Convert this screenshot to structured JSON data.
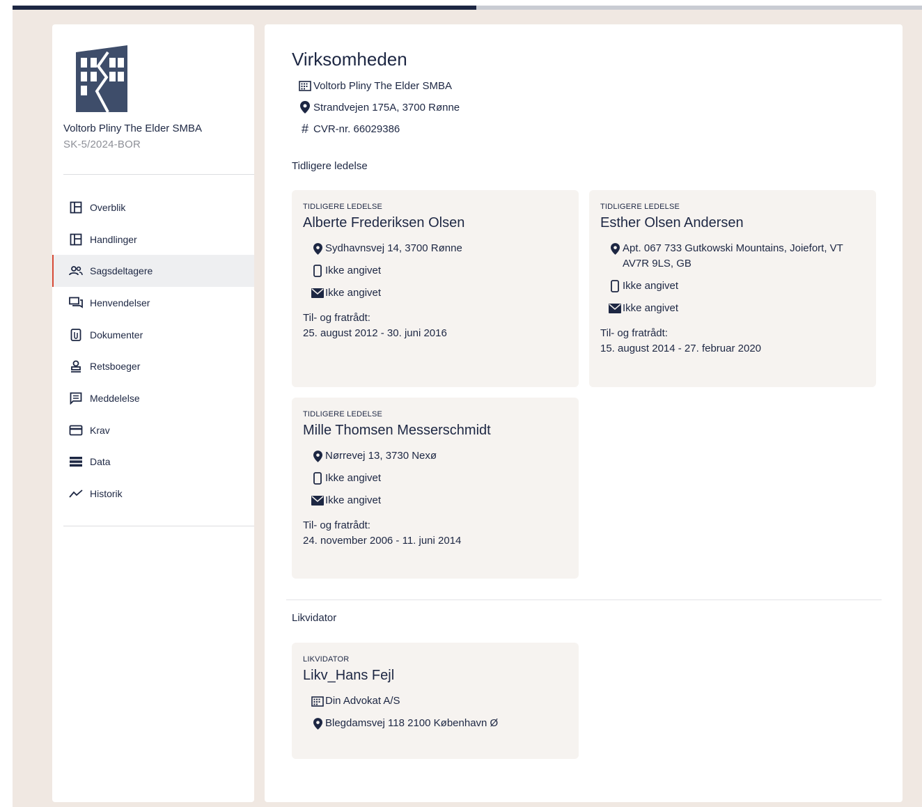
{
  "progress": {
    "fraction": 0.51
  },
  "sidebar": {
    "company_name": "Voltorb Pliny The Elder SMBA",
    "case_number": "SK-5/2024-BOR",
    "items": [
      {
        "label": "Overblik",
        "icon": "layout-icon"
      },
      {
        "label": "Handlinger",
        "icon": "layout-icon"
      },
      {
        "label": "Sagsdeltagere",
        "icon": "people-icon",
        "active": true
      },
      {
        "label": "Henvendelser",
        "icon": "chat-icon"
      },
      {
        "label": "Dokumenter",
        "icon": "document-icon"
      },
      {
        "label": "Retsboeger",
        "icon": "stamp-icon"
      },
      {
        "label": "Meddelelse",
        "icon": "message-icon"
      },
      {
        "label": "Krav",
        "icon": "card-icon"
      },
      {
        "label": "Data",
        "icon": "list-icon"
      },
      {
        "label": "Historik",
        "icon": "trend-icon"
      }
    ]
  },
  "main": {
    "title": "Virksomheden",
    "company_line": "Voltorb Pliny The Elder SMBA",
    "address_line": "Strandvejen 175A, 3700 Rønne",
    "cvr_line": "CVR-nr. 66029386",
    "section_previous": "Tidligere ledelse",
    "section_liquidator": "Likvidator",
    "period_label": "Til- og fratrådt:",
    "previous_management": [
      {
        "kicker": "TIDLIGERE LEDELSE",
        "name": "Alberte Frederiksen Olsen",
        "address": "Sydhavnsvej 14, 3700 Rønne",
        "phone": "Ikke angivet",
        "email": "Ikke angivet",
        "period": "25. august 2012 - 30. juni 2016"
      },
      {
        "kicker": "TIDLIGERE LEDELSE",
        "name": "Esther Olsen Andersen",
        "address": "Apt. 067 733 Gutkowski Mountains, Joiefort, VT AV7R 9LS, GB",
        "phone": "Ikke angivet",
        "email": "Ikke angivet",
        "period": "15. august 2014 - 27. februar 2020"
      },
      {
        "kicker": "TIDLIGERE LEDELSE",
        "name": "Mille Thomsen Messerschmidt",
        "address": "Nørrevej 13, 3730 Nexø",
        "phone": "Ikke angivet",
        "email": "Ikke angivet",
        "period": "24. november 2006 - 11. juni 2014"
      }
    ],
    "liquidator": {
      "kicker": "LIKVIDATOR",
      "name": "Likv_Hans Fejl",
      "firm": "Din Advokat A/S",
      "address": "Blegdamsvej 118 2100 København Ø"
    }
  }
}
